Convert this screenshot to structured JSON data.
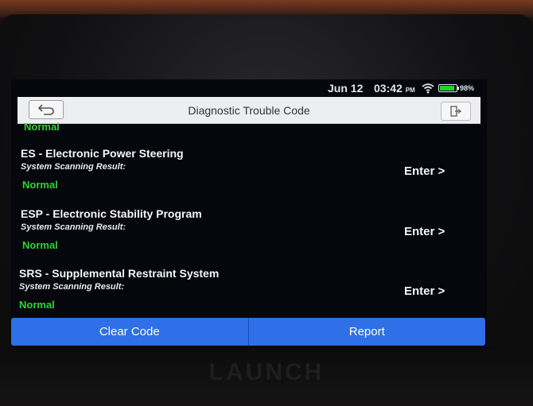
{
  "device": {
    "brand": "LAUNCH"
  },
  "status": {
    "date": "Jun 12",
    "time": "03:42",
    "ampm": "PM",
    "battery": "98%"
  },
  "header": {
    "title": "Diagnostic Trouble Code"
  },
  "list": {
    "partial_status": "Normal",
    "items": [
      {
        "title": "ES - Electronic Power Steering",
        "label": "System Scanning Result:",
        "status": "Normal",
        "action": "Enter >"
      },
      {
        "title": "ESP - Electronic Stability Program",
        "label": "System Scanning Result:",
        "status": "Normal",
        "action": "Enter >"
      },
      {
        "title": "SRS - Supplemental Restraint System",
        "label": "System Scanning Result:",
        "status": "Normal",
        "action": "Enter >"
      }
    ]
  },
  "footer": {
    "clear_label": "Clear Code",
    "report_label": "Report"
  },
  "colors": {
    "accent": "#2f6fe8",
    "status_ok": "#2fd138",
    "screen_bg": "#05070c"
  },
  "icons": {
    "back": "back-arrow-icon",
    "exit": "exit-icon",
    "wifi": "wifi-icon",
    "battery": "battery-icon"
  }
}
